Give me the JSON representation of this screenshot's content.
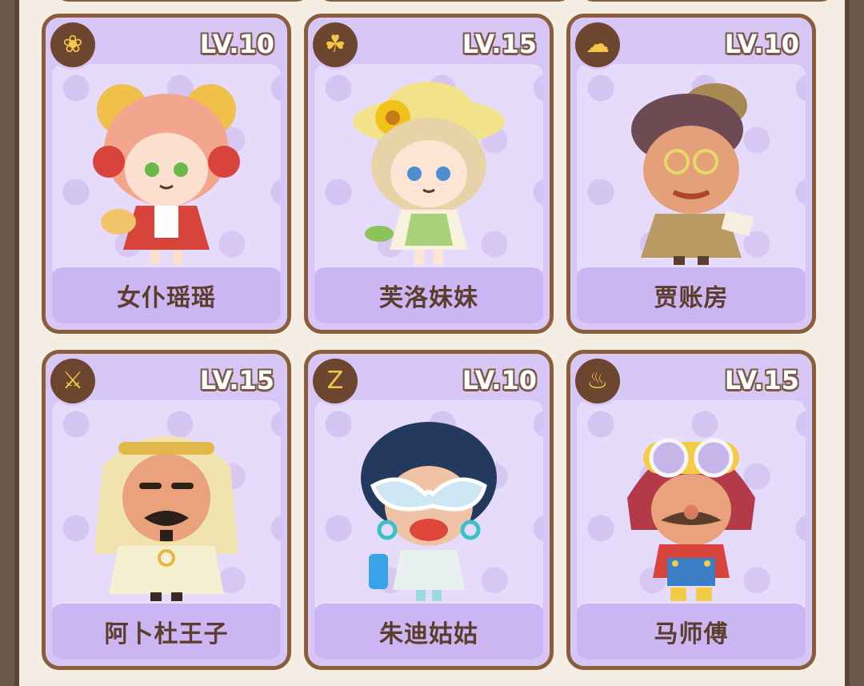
{
  "cards": [
    {
      "name": "女仆瑶瑶",
      "level": "LV.10",
      "skill_icon": "bread-icon",
      "palette": {
        "hair": "#f3a68e",
        "accent": "#f0c04a",
        "outfit": "#d8443a"
      }
    },
    {
      "name": "芙洛妹妹",
      "level": "LV.15",
      "skill_icon": "sprout-icon",
      "palette": {
        "hair": "#e8d3a8",
        "accent": "#f2e38a",
        "outfit": "#a8d27a"
      }
    },
    {
      "name": "贾账房",
      "level": "LV.10",
      "skill_icon": "cloud-icon",
      "palette": {
        "hair": "#6e4a52",
        "accent": "#a98952",
        "outfit": "#b89a62"
      }
    },
    {
      "name": "阿卜杜王子",
      "level": "LV.15",
      "skill_icon": "utensils-icon",
      "palette": {
        "hair": "#f1e3b0",
        "accent": "#e2b84a",
        "outfit": "#f6efd0"
      }
    },
    {
      "name": "朱迪姑姑",
      "level": "LV.10",
      "skill_icon": "sleep-icon",
      "palette": {
        "hair": "#24395e",
        "accent": "#cfe6f5",
        "outfit": "#e9f0f0"
      }
    },
    {
      "name": "马师傅",
      "level": "LV.15",
      "skill_icon": "bowl-icon",
      "palette": {
        "hair": "#b43a4a",
        "accent": "#f2cc45",
        "outfit": "#3a7ec8"
      }
    }
  ]
}
